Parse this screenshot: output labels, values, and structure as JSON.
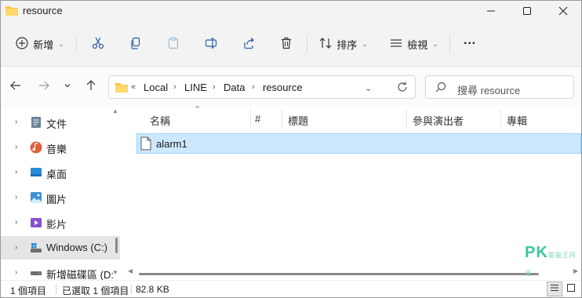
{
  "window": {
    "title": "resource"
  },
  "toolbar": {
    "new_label": "新增",
    "sort_label": "排序",
    "view_label": "檢視",
    "more_label": "···"
  },
  "address": {
    "overflow": "«",
    "crumbs": [
      "Local",
      "LINE",
      "Data",
      "resource"
    ]
  },
  "search": {
    "placeholder": "搜尋 resource"
  },
  "sidebar": {
    "items": [
      {
        "label": "文件"
      },
      {
        "label": "音樂"
      },
      {
        "label": "桌面"
      },
      {
        "label": "圖片"
      },
      {
        "label": "影片"
      },
      {
        "label": "Windows (C:)"
      },
      {
        "label": "新增磁碟區 (D:"
      }
    ]
  },
  "columns": {
    "name": "名稱",
    "number": "#",
    "title": "標題",
    "artist": "參與演出者",
    "album": "專輯"
  },
  "files": [
    {
      "name": "alarm1"
    }
  ],
  "status": {
    "count": "1 個項目",
    "selected": "已選取 1 個項目",
    "size": "82.8 KB"
  },
  "watermark": {
    "text": "PK",
    "sub": "電腦王阿達"
  },
  "colors": {
    "selection": "#cce8ff",
    "accent": "#0067c0",
    "folder": "#f8c44c"
  }
}
